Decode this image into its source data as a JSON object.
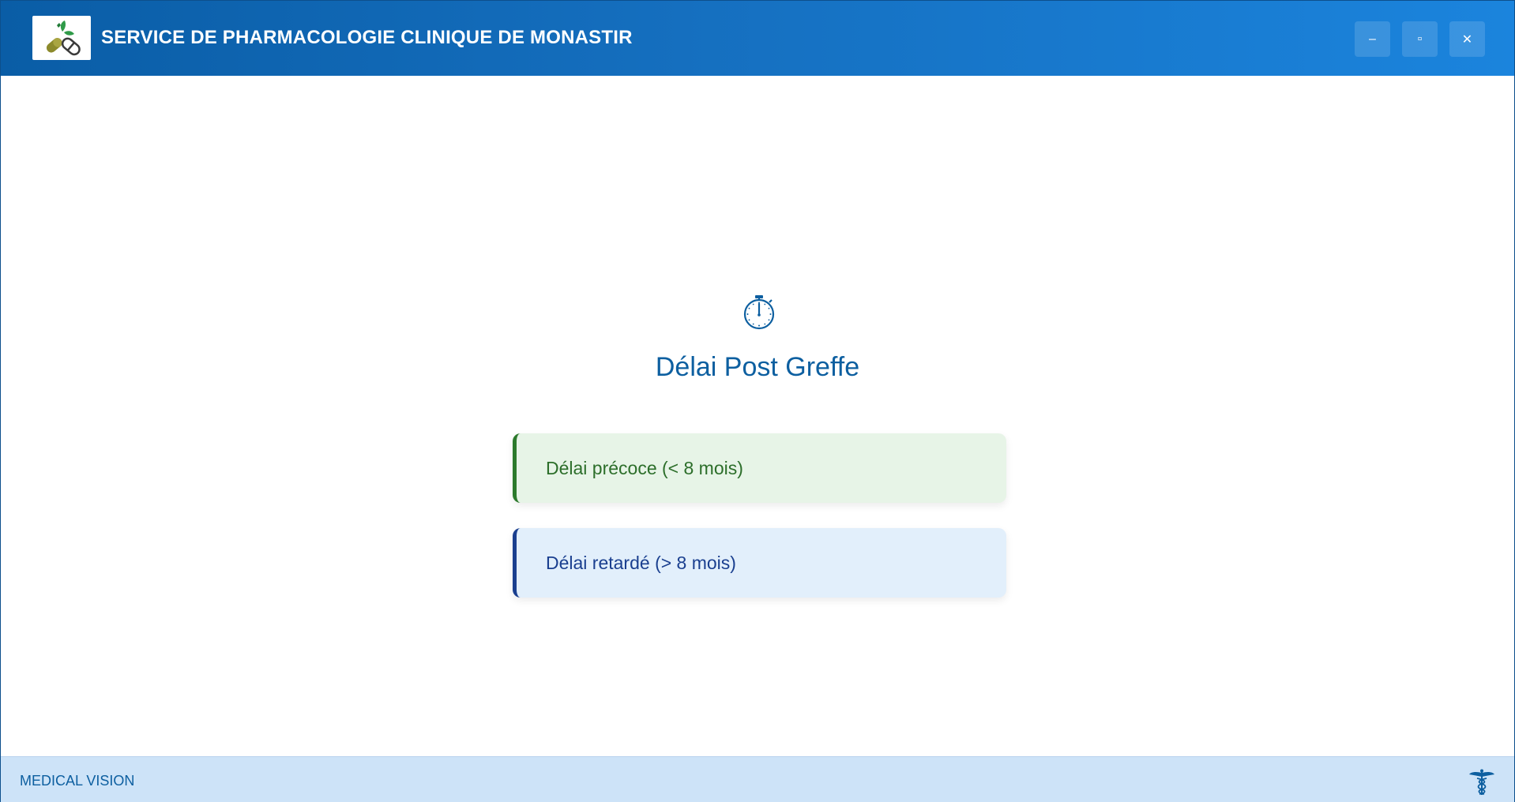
{
  "header": {
    "title": "SERVICE DE PHARMACOLOGIE CLINIQUE DE MONASTIR",
    "logo_icon": "pills-leaf-logo",
    "minimize_label": "–",
    "maximize_label": "▫",
    "close_label": "✕"
  },
  "main": {
    "icon": "stopwatch-icon",
    "title": "Délai Post Greffe",
    "options": [
      {
        "label": "Délai précoce (< 8 mois)",
        "accent": "#2c7a2c",
        "background": "#e7f4e7"
      },
      {
        "label": "Délai retardé (> 8 mois)",
        "accent": "#1a3f8f",
        "background": "#e2effb"
      }
    ]
  },
  "footer": {
    "brand": "MEDICAL VISION",
    "icon": "caduceus-icon"
  },
  "colors": {
    "header_start": "#0a5da6",
    "header_end": "#1b84dd",
    "title_blue": "#0d5fa0",
    "footer_bg": "#cde3f8"
  }
}
